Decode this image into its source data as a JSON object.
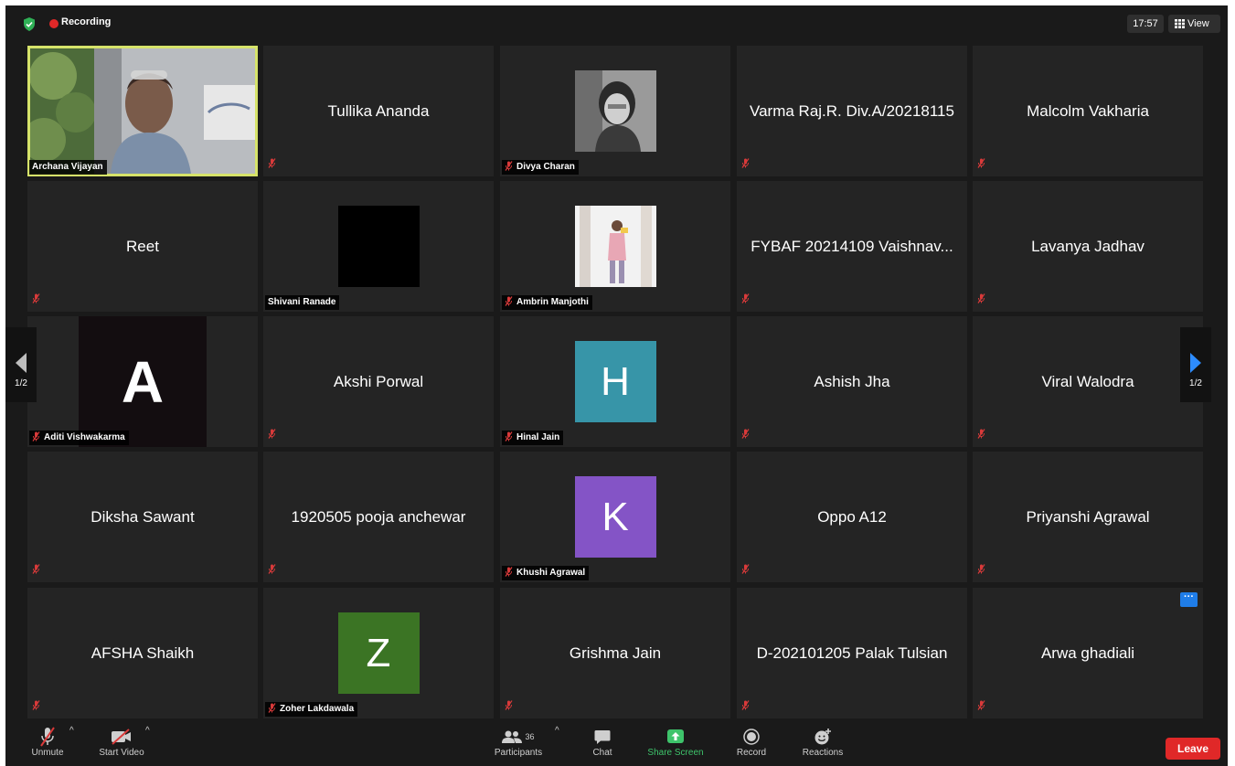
{
  "topbar": {
    "recording_label": "Recording",
    "time": "17:57",
    "view_label": "View"
  },
  "pagination": {
    "left_page": "1/2",
    "right_page": "1/2"
  },
  "tiles": [
    {
      "name": "Archana Vijayan",
      "mode": "video",
      "active": true
    },
    {
      "name": "Tullika Ananda",
      "mode": "name"
    },
    {
      "name": "Divya Charan",
      "mode": "photo"
    },
    {
      "name": "Varma Raj.R. Div.A/20218115",
      "mode": "name"
    },
    {
      "name": "Malcolm Vakharia",
      "mode": "name"
    },
    {
      "name": "Reet",
      "mode": "name"
    },
    {
      "name": "Shivani Ranade",
      "mode": "photo"
    },
    {
      "name": "Ambrin Manjothi",
      "mode": "photo"
    },
    {
      "name": "FYBAF 20214109 Vaishnav...",
      "mode": "name"
    },
    {
      "name": "Lavanya Jadhav",
      "mode": "name"
    },
    {
      "name": "Aditi Vishwakarma",
      "mode": "letter",
      "letter": "A",
      "color": "#130d10"
    },
    {
      "name": "Akshi Porwal",
      "mode": "name"
    },
    {
      "name": "Hinal Jain",
      "mode": "letter",
      "letter": "H",
      "color": "#3795a8"
    },
    {
      "name": "Ashish Jha",
      "mode": "name"
    },
    {
      "name": "Viral Walodra",
      "mode": "name"
    },
    {
      "name": "Diksha Sawant",
      "mode": "name"
    },
    {
      "name": "1920505 pooja anchewar",
      "mode": "name"
    },
    {
      "name": "Khushi Agrawal",
      "mode": "letter",
      "letter": "K",
      "color": "#8454c6"
    },
    {
      "name": "Oppo A12",
      "mode": "name"
    },
    {
      "name": "Priyanshi Agrawal",
      "mode": "name"
    },
    {
      "name": "AFSHA Shaikh",
      "mode": "name"
    },
    {
      "name": "Zoher Lakdawala",
      "mode": "letter",
      "letter": "Z",
      "color": "#3b7424"
    },
    {
      "name": "Grishma Jain",
      "mode": "name"
    },
    {
      "name": "D-202101205 Palak Tulsian",
      "mode": "name"
    },
    {
      "name": "Arwa ghadiali",
      "mode": "name",
      "more_button": true
    }
  ],
  "more_button_label": "···",
  "toolbar": {
    "unmute": "Unmute",
    "start_video": "Start Video",
    "participants": "Participants",
    "participant_count": "36",
    "chat": "Chat",
    "share_screen": "Share Screen",
    "record": "Record",
    "reactions": "Reactions",
    "leave": "Leave"
  },
  "colors": {
    "background": "#1a1a1a",
    "tile": "#242424",
    "active_speaker_border": "#d6e36a",
    "recording": "#e02828",
    "share_green": "#3ec46b",
    "leave_red": "#e02828",
    "more_blue": "#1f7de8",
    "muted_mic": "#d93a3a"
  }
}
